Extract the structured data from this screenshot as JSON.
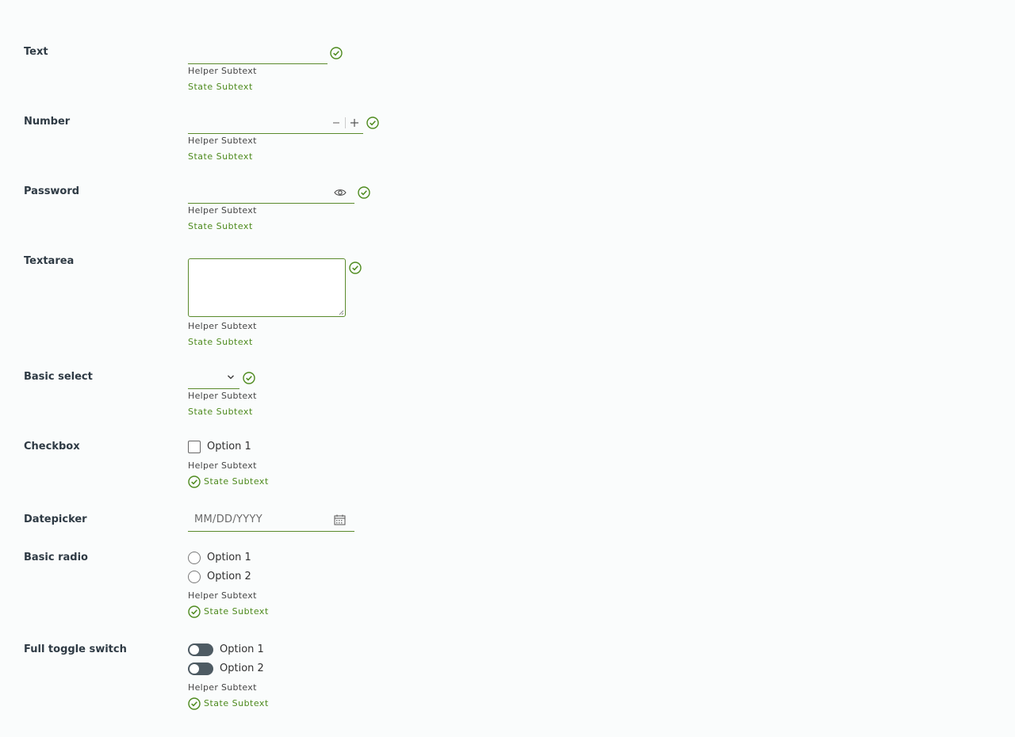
{
  "colors": {
    "success": "#4d8a1d",
    "label": "#2e3a44",
    "toggle_off": "#4e5b63"
  },
  "helper_text": "Helper Subtext",
  "state_text": "State Subtext",
  "fields": {
    "text": {
      "label": "Text"
    },
    "number": {
      "label": "Number"
    },
    "password": {
      "label": "Password"
    },
    "textarea": {
      "label": "Textarea"
    },
    "select": {
      "label": "Basic select",
      "value": ""
    },
    "checkbox": {
      "label": "Checkbox",
      "options": [
        "Option 1"
      ]
    },
    "datepicker": {
      "label": "Datepicker",
      "placeholder": "MM/DD/YYYY"
    },
    "radio": {
      "label": "Basic radio",
      "options": [
        "Option 1",
        "Option 2"
      ]
    },
    "toggle": {
      "label": "Full toggle switch",
      "options": [
        "Option 1",
        "Option 2"
      ]
    }
  },
  "icons": [
    "success-check-icon",
    "minus-icon",
    "plus-icon",
    "eye-icon",
    "chevron-down-icon",
    "calendar-icon"
  ]
}
